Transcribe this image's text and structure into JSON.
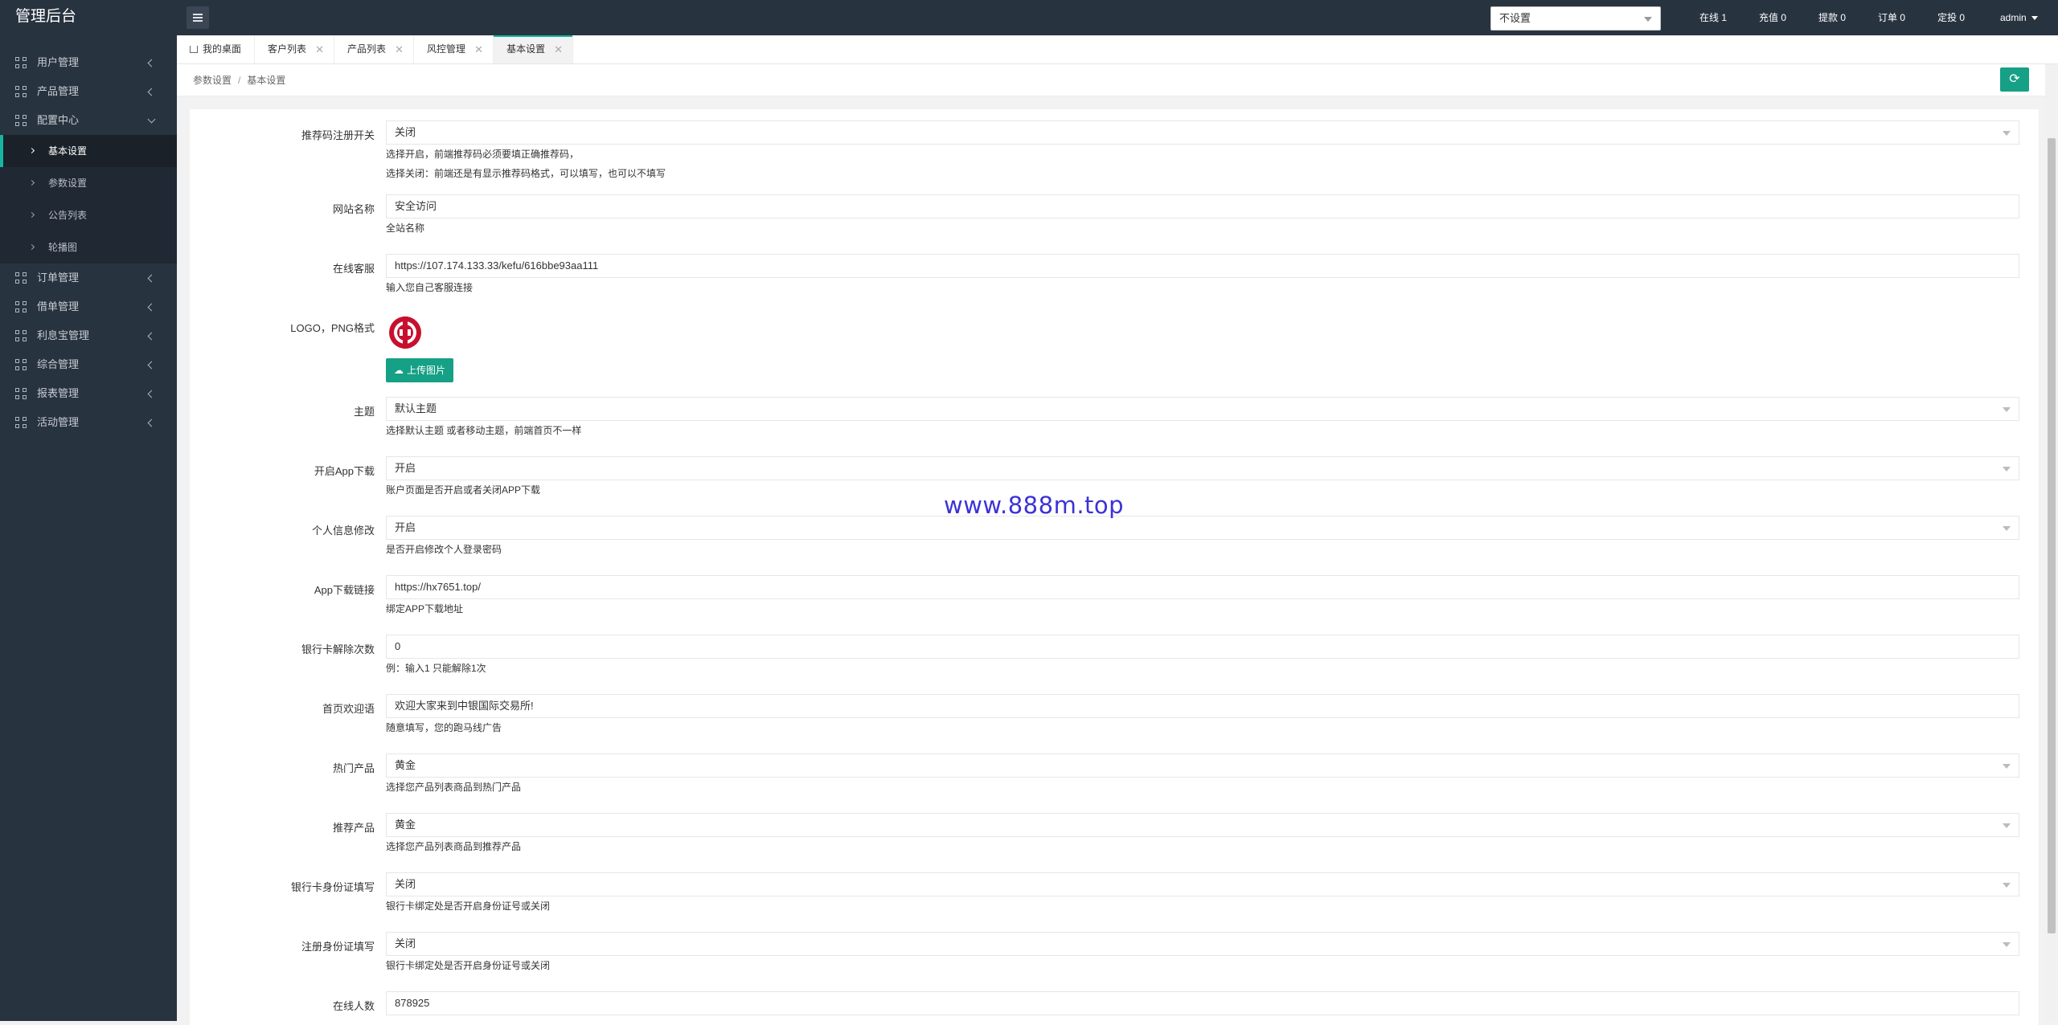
{
  "app": {
    "title": "管理后台"
  },
  "sidebar": {
    "items": [
      {
        "label": "用户管理",
        "icon": "grid-icon"
      },
      {
        "label": "产品管理",
        "icon": "grid-icon"
      },
      {
        "label": "配置中心",
        "icon": "grid-icon",
        "expanded": true
      },
      {
        "label": "订单管理",
        "icon": "grid-icon"
      },
      {
        "label": "借单管理",
        "icon": "grid-icon"
      },
      {
        "label": "利息宝管理",
        "icon": "grid-icon"
      },
      {
        "label": "综合管理",
        "icon": "grid-icon"
      },
      {
        "label": "报表管理",
        "icon": "grid-icon"
      },
      {
        "label": "活动管理",
        "icon": "grid-icon"
      }
    ],
    "sub_items": [
      {
        "label": "基本设置",
        "active": true
      },
      {
        "label": "参数设置"
      },
      {
        "label": "公告列表"
      },
      {
        "label": "轮播图"
      }
    ]
  },
  "topbar": {
    "select_value": "不设置",
    "stats": [
      "在线 1",
      "充值 0",
      "提款 0",
      "订单 0",
      "定投 0"
    ],
    "user": "admin"
  },
  "tabs": [
    {
      "label": "我的桌面",
      "home": true
    },
    {
      "label": "客户列表"
    },
    {
      "label": "产品列表"
    },
    {
      "label": "风控管理"
    },
    {
      "label": "基本设置",
      "active": true
    }
  ],
  "breadcrumb": {
    "parent": "参数设置",
    "current": "基本设置",
    "separator": "/"
  },
  "form": {
    "referral": {
      "label": "推荐码注册开关",
      "value": "关闭",
      "help1": "选择开启，前端推荐码必须要填正确推荐码，",
      "help2": "选择关闭：前端还是有显示推荐码格式，可以填写，也可以不填写"
    },
    "site_name": {
      "label": "网站名称",
      "value": "安全访问",
      "help": "全站名称"
    },
    "service": {
      "label": "在线客服",
      "value": "https://107.174.133.33/kefu/616bbe93aa111",
      "help": "输入您自己客服连接"
    },
    "logo": {
      "label": "LOGO，PNG格式",
      "upload_label": "上传图片"
    },
    "theme": {
      "label": "主题",
      "value": "默认主题",
      "help": "选择默认主题 或者移动主题，前端首页不一样"
    },
    "app_download": {
      "label": "开启App下载",
      "value": "开启",
      "help": "账户页面是否开启或者关闭APP下载"
    },
    "profile_edit": {
      "label": "个人信息修改",
      "value": "开启",
      "help": "是否开启修改个人登录密码"
    },
    "app_link": {
      "label": "App下载链接",
      "value": "https://hx7651.top/",
      "help": "绑定APP下载地址"
    },
    "bank_unbind": {
      "label": "银行卡解除次数",
      "value": "0",
      "help": "例：输入1 只能解除1次"
    },
    "welcome": {
      "label": "首页欢迎语",
      "value": "欢迎大家来到中银国际交易所!",
      "help": "随意填写，您的跑马线广告"
    },
    "hot_product": {
      "label": "热门产品",
      "value": "黄金",
      "help": "选择您产品列表商品到热门产品"
    },
    "recommend": {
      "label": "推荐产品",
      "value": "黄金",
      "help": "选择您产品列表商品到推荐产品"
    },
    "bank_id": {
      "label": "银行卡身份证填写",
      "value": "关闭",
      "help": "银行卡绑定处是否开启身份证号或关闭"
    },
    "register_id": {
      "label": "注册身份证填写",
      "value": "关闭",
      "help": "银行卡绑定处是否开启身份证号或关闭"
    },
    "online_count": {
      "label": "在线人数",
      "value": "878925"
    }
  },
  "watermark": "www.888m.top",
  "colors": {
    "sidebar_bg": "#283340",
    "accent": "#16a085",
    "active_tab_line": "#16b5a0",
    "watermark": "#3b32d6",
    "logo_red": "#c8102e"
  }
}
